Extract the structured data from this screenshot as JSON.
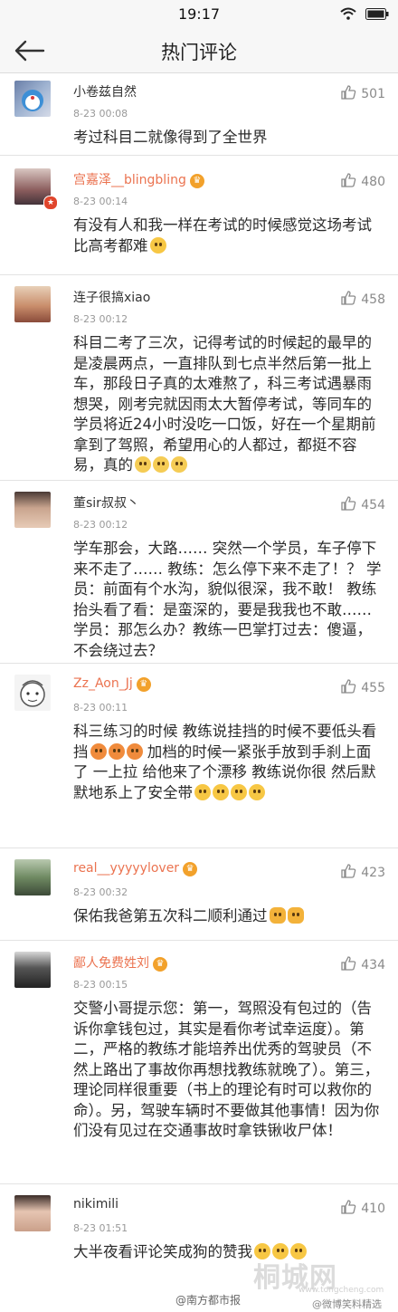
{
  "status": {
    "time": "19:17"
  },
  "header": {
    "title": "热门评论"
  },
  "comments": [
    {
      "user": "小卷兹自然",
      "time": "8-23 00:08",
      "likes": "501",
      "text": "考过科目二就像得到了全世界",
      "vip": false
    },
    {
      "user": "宫嘉泽__blingbling",
      "time": "8-23 00:14",
      "likes": "480",
      "text": "有没有人和我一样在考试的时候感觉这场考试比高考都难",
      "vip": true
    },
    {
      "user": "连子很搞xiao",
      "time": "8-23 00:12",
      "likes": "458",
      "text": "科目二考了三次，记得考试的时候起的最早的是凌晨两点，一直排队到七点半然后第一批上车，那段日子真的太难熬了，科三考试遇暴雨想哭，刚考完就因雨太大暂停考试，等同车的学员将近24小时没吃一口饭，好在一个星期前拿到了驾照，希望用心的人都过，都挺不容易，真的",
      "vip": false
    },
    {
      "user": "董sir叔叔丶",
      "time": "8-23 00:12",
      "likes": "454",
      "text": "学车那会，大路…… 突然一个学员，车子停下来不走了…… 教练：怎么停下来不走了！？ 学员：前面有个水沟，貌似很深，我不敢！ 教练抬头看了看：是蛮深的，要是我我也不敢…… 学员：那怎么办？教练一巴掌打过去：傻逼，不会绕过去？",
      "vip": false
    },
    {
      "user": "Zz_Aon_Jj",
      "time": "8-23 00:11",
      "likes": "455",
      "text": "科三练习的时候 教练说挂挡的时候不要低头看挡",
      "text2": " 加档的时候一紧张手放到手刹上面了 一上拉 给他来了个漂移  教练说你很 然后默默地系上了安全带",
      "vip": true
    },
    {
      "user": "real__yyyyylover",
      "time": "8-23 00:32",
      "likes": "423",
      "text": "保佑我爸第五次科二顺利通过",
      "vip": true
    },
    {
      "user": "鄙人免费姓刘",
      "time": "8-23 00:15",
      "likes": "434",
      "text": "交警小哥提示您：第一，驾照没有包过的（告诉你拿钱包过，其实是看你考试幸运度）。第二，严格的教练才能培养出优秀的驾驶员（不然上路出了事故你再想找教练就晚了）。第三，理论同样很重要（书上的理论有时可以救你的命）。另，驾驶车辆时不要做其他事情！因为你们没有见过在交通事故时拿铁锹收尸体！",
      "vip": true
    },
    {
      "user": "nikimili",
      "time": "8-23 01:51",
      "likes": "410",
      "text": "大半夜看评论笑成狗的赞我",
      "vip": false
    }
  ],
  "watermark": {
    "brand": "桐城网",
    "site": "www.tongcheng.com"
  },
  "credits": {
    "left": "@南方都市报",
    "right": "@微博笑料精选"
  },
  "colors": {
    "vip_name": "#eb7350",
    "time": "#999999",
    "divider": "#e3e3e3"
  },
  "icons": {
    "back": "back-arrow-icon",
    "like": "thumbs-up-icon",
    "wifi": "wifi-icon",
    "battery": "battery-icon"
  }
}
